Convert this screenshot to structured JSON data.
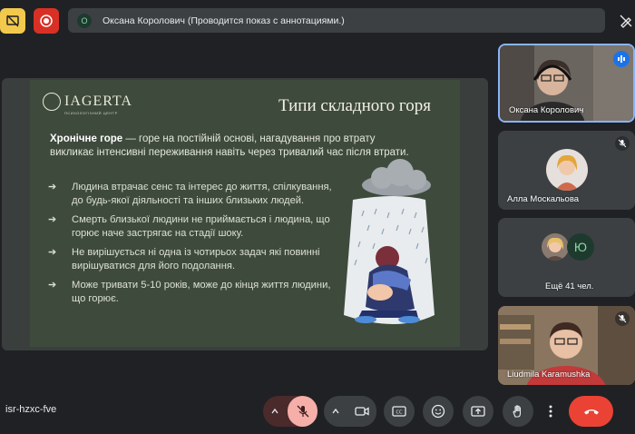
{
  "topbar": {
    "presenter_initial": "О",
    "presenter_status": "Оксана Королович (Проводится показ с аннотациями.)"
  },
  "slide": {
    "logo_text": "IAGERTA",
    "logo_subtitle": "ПСИХОЛОГІЧНИЙ ЦЕНТР",
    "title": "Типи складного горя",
    "lead_term": "Хронічне горе",
    "lead_text": " — горе на постійній основі, нагадування про втрату викликає інтенсивні переживання навіть через тривалий час після втрати.",
    "bullets": [
      "Людина втрачає сенс та інтерес до життя, спілкування, до будь-якої діяльності та інших близьких людей.",
      "Смерть близької людини не приймається і людина, що горює наче застрягає на стадії шоку.",
      "Не вирішується ні одна із чотирьох задач які повинні вирішуватися для його подолання.",
      "Може тривати 5-10 років, може до кінця життя людини, що горює."
    ]
  },
  "participants": [
    {
      "name": "Оксана Королович"
    },
    {
      "name": "Алла Москальова"
    },
    {
      "name": "Ещё 41 чел.",
      "letter": "Ю"
    },
    {
      "name": "Liudmila Karamushka"
    }
  ],
  "bottombar": {
    "meeting_code": "isr-hzxc-fve"
  },
  "colors": {
    "background": "#202124",
    "slide_bg": "#3e4a3c",
    "accent_blue": "#8ab4f8",
    "leave_red": "#ea4335",
    "mic_off": "#f6aea9"
  }
}
